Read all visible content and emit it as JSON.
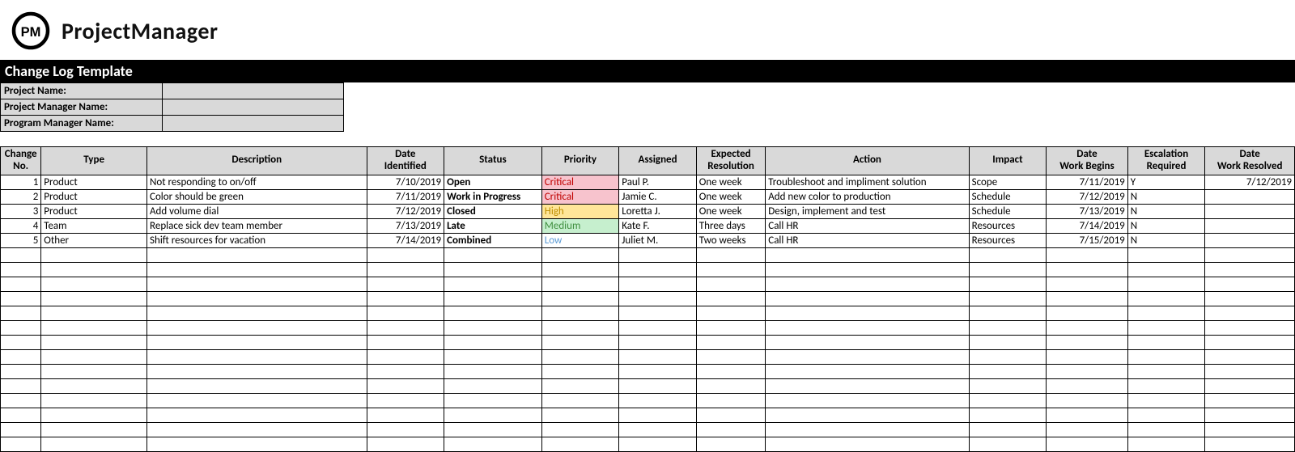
{
  "brand": {
    "logo_initials": "PM",
    "name": "ProjectManager"
  },
  "title": "Change Log Template",
  "meta": [
    {
      "label": "Project Name:",
      "value": ""
    },
    {
      "label": "Project Manager Name:",
      "value": ""
    },
    {
      "label": "Program Manager Name:",
      "value": ""
    }
  ],
  "columns": [
    {
      "key": "no",
      "label": "Change\nNo."
    },
    {
      "key": "type",
      "label": "Type"
    },
    {
      "key": "description",
      "label": "Description"
    },
    {
      "key": "date_identified",
      "label": "Date\nIdentified"
    },
    {
      "key": "status",
      "label": "Status"
    },
    {
      "key": "priority",
      "label": "Priority"
    },
    {
      "key": "assigned",
      "label": "Assigned"
    },
    {
      "key": "expected_resolution",
      "label": "Expected\nResolution"
    },
    {
      "key": "action",
      "label": "Action"
    },
    {
      "key": "impact",
      "label": "Impact"
    },
    {
      "key": "date_work_begins",
      "label": "Date\nWork Begins"
    },
    {
      "key": "escalation_required",
      "label": "Escalation\nRequired"
    },
    {
      "key": "date_work_resolved",
      "label": "Date\nWork Resolved"
    }
  ],
  "rows": [
    {
      "no": "1",
      "type": "Product",
      "description": "Not responding to on/off",
      "date_identified": "7/10/2019",
      "status": "Open",
      "priority": "Critical",
      "assigned": "Paul P.",
      "expected_resolution": "One week",
      "action": "Troubleshoot and impliment solution",
      "impact": "Scope",
      "date_work_begins": "7/11/2019",
      "escalation_required": "Y",
      "date_work_resolved": "7/12/2019"
    },
    {
      "no": "2",
      "type": "Product",
      "description": "Color should be green",
      "date_identified": "7/11/2019",
      "status": "Work in Progress",
      "priority": "Critical",
      "assigned": "Jamie C.",
      "expected_resolution": "One week",
      "action": "Add new color to production",
      "impact": "Schedule",
      "date_work_begins": "7/12/2019",
      "escalation_required": "N",
      "date_work_resolved": ""
    },
    {
      "no": "3",
      "type": "Product",
      "description": "Add volume dial",
      "date_identified": "7/12/2019",
      "status": "Closed",
      "priority": "High",
      "assigned": "Loretta J.",
      "expected_resolution": "One week",
      "action": "Design, implement and test",
      "impact": "Schedule",
      "date_work_begins": "7/13/2019",
      "escalation_required": "N",
      "date_work_resolved": ""
    },
    {
      "no": "4",
      "type": "Team",
      "description": "Replace sick dev team member",
      "date_identified": "7/13/2019",
      "status": "Late",
      "priority": "Medium",
      "assigned": "Kate F.",
      "expected_resolution": "Three days",
      "action": "Call HR",
      "impact": "Resources",
      "date_work_begins": "7/14/2019",
      "escalation_required": "N",
      "date_work_resolved": ""
    },
    {
      "no": "5",
      "type": "Other",
      "description": "Shift resources for vacation",
      "date_identified": "7/14/2019",
      "status": "Combined",
      "priority": "Low",
      "assigned": "Juliet M.",
      "expected_resolution": "Two weeks",
      "action": "Call HR",
      "impact": "Resources",
      "date_work_begins": "7/15/2019",
      "escalation_required": "N",
      "date_work_resolved": ""
    }
  ],
  "empty_rows": 14
}
